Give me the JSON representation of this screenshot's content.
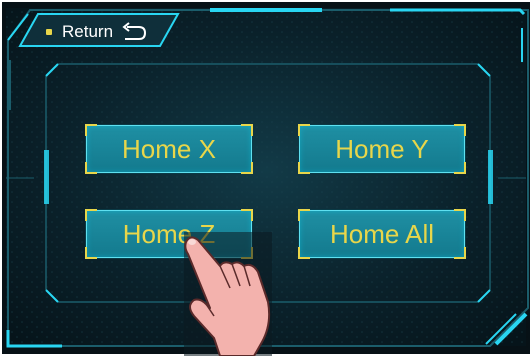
{
  "header": {
    "return_label": "Return"
  },
  "buttons": [
    {
      "label": "Home X"
    },
    {
      "label": "Home Y"
    },
    {
      "label": "Home Z"
    },
    {
      "label": "Home All"
    }
  ],
  "colors": {
    "accent": "#e8d64a",
    "frame": "#1ec8e8",
    "panel": "#0b2530",
    "button": "#1a8799"
  },
  "icons": {
    "return": "return-arrow-icon",
    "pointer": "pointing-hand-icon"
  }
}
